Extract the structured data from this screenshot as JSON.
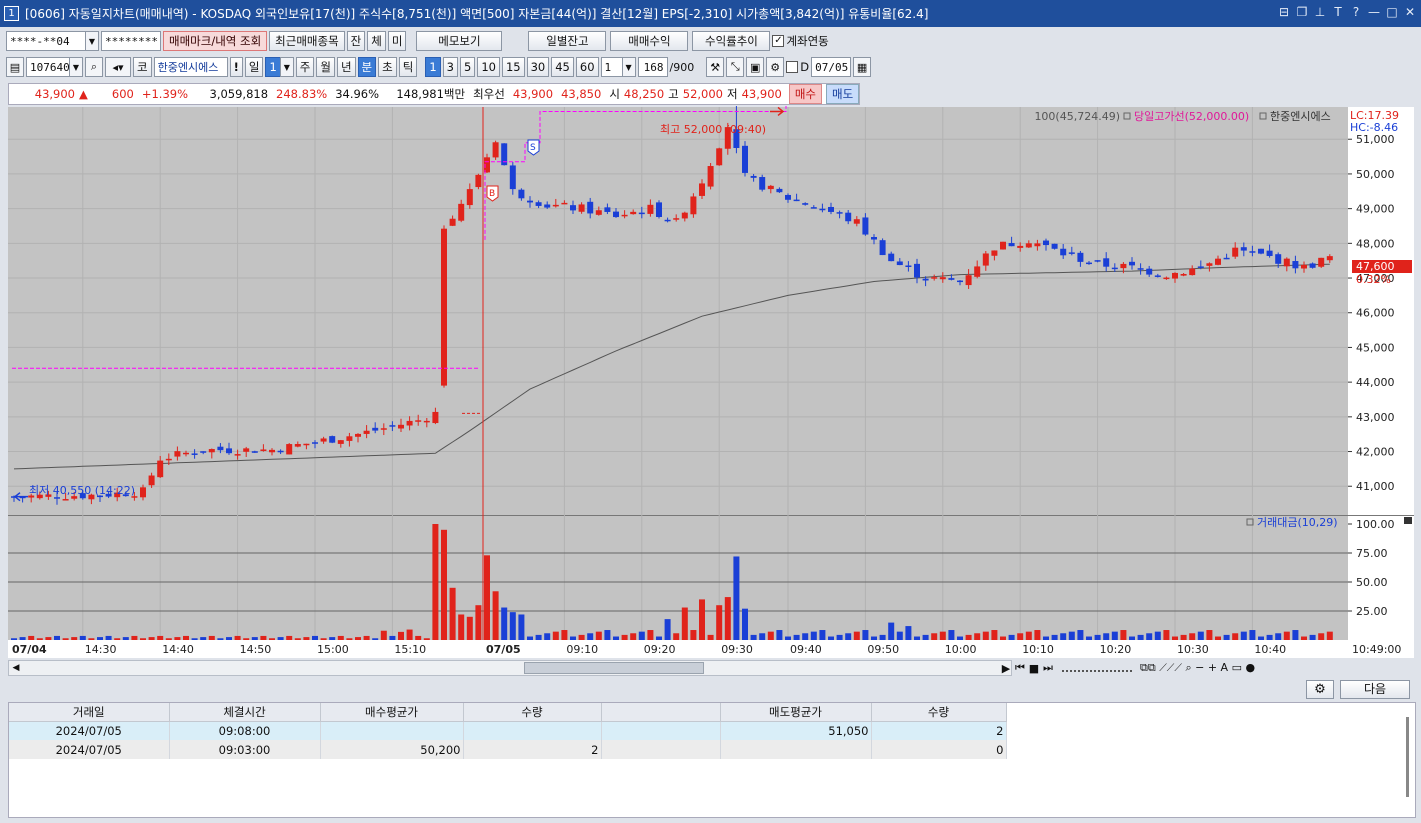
{
  "window": {
    "number": "1",
    "title": "[0606] 자동일지차트(매매내역) - KOSDAQ 외국인보유[17(천)] 주식수[8,751(천)] 액면[500] 자본금[44(억)] 결산[12월] EPS[-2,310] 시가총액[3,842(억)] 유통비율[62.4]"
  },
  "toolbar1": {
    "account": "****-**04",
    "password": "********",
    "btn_mark": "매매마크/내역 조회",
    "btn_recent": "최근매매종목",
    "btn_jan": "잔",
    "btn_che": "체",
    "btn_mi": "미",
    "btn_memo": "메모보기",
    "btn_daily": "일별잔고",
    "btn_profit": "매매수익",
    "btn_rate": "수익률추이",
    "link_label": "계좌연동"
  },
  "toolbar2": {
    "code": "107640",
    "market": "코",
    "name": "한중엔시에스",
    "excl": "!",
    "il": "일",
    "il_num": "1",
    "ju": "주",
    "wol": "월",
    "nyeon": "년",
    "bun": "분",
    "cho": "초",
    "tik": "틱",
    "intervals": [
      "1",
      "3",
      "5",
      "10",
      "15",
      "30",
      "45",
      "60"
    ],
    "mult": "1",
    "count": "168",
    "total": "/900",
    "d_label": "D",
    "date": "07/05"
  },
  "quote": {
    "price": "43,900",
    "arrow": "▲",
    "change": "600",
    "pct": "+1.39%",
    "volume": "3,059,818",
    "vol_ratio": "248.83%",
    "turnover": "34.96%",
    "amount": "148,981백만",
    "best_label": "최우선",
    "best_ask": "43,900",
    "best_bid": "43,850",
    "open_label": "시",
    "open": "48,250",
    "high_label": "고",
    "high": "52,000",
    "low_label": "저",
    "low": "43,900",
    "buy": "매수",
    "sell": "매도"
  },
  "colors": {
    "up": "#e0231b",
    "down": "#1a3fd6",
    "plot_bg": "#c3c3c3",
    "ma": "#555555",
    "highline": "#ff00ff"
  },
  "chart_data": {
    "type": "candlestick",
    "price_ticks": [
      "51,000",
      "50,000",
      "49,000",
      "48,000",
      "47,000",
      "46,000",
      "45,000",
      "44,000",
      "43,000",
      "42,000",
      "41,000"
    ],
    "lc_label": "LC:17.39",
    "hc_label": "HC:-8.46",
    "legend_ma": "100(45,724.49)",
    "legend_high": "당일고가선(52,000.00)",
    "legend_name": "한중엔시에스",
    "current_price": "47,600",
    "current_pct": "0.32%",
    "high_annotation": "최고 52,000 (09:40)",
    "low_annotation": "최저 40,550 (14:22)",
    "buy_marker": "B",
    "sell_marker": "S",
    "volume_title": "거래대금(10,29)",
    "volume_ticks": [
      "100.00",
      "75.00",
      "50.00",
      "25.00"
    ],
    "time_labels": [
      "07/04",
      "14:30",
      "14:40",
      "14:50",
      "15:00",
      "15:10",
      "07/05",
      "09:10",
      "09:20",
      "09:30",
      "09:40",
      "09:50",
      "10:00",
      "10:10",
      "10:20",
      "10:30",
      "10:40",
      "10:49:00"
    ],
    "prev_close_line": 44400,
    "day_high": 52000,
    "day_low": 40550,
    "ylim": [
      40200,
      51900
    ],
    "anchors": [
      [
        0,
        40700
      ],
      [
        10,
        40750
      ],
      [
        15,
        40850
      ],
      [
        17,
        41800
      ],
      [
        22,
        42050
      ],
      [
        30,
        42050
      ],
      [
        40,
        42500
      ],
      [
        47,
        42900
      ],
      [
        49,
        43100
      ],
      [
        50,
        48500
      ],
      [
        53,
        49500
      ],
      [
        56,
        51000
      ],
      [
        58,
        49500
      ],
      [
        62,
        49100
      ],
      [
        66,
        49000
      ],
      [
        70,
        48800
      ],
      [
        74,
        49000
      ],
      [
        77,
        48600
      ],
      [
        80,
        49800
      ],
      [
        83,
        51400
      ],
      [
        85,
        49900
      ],
      [
        90,
        49300
      ],
      [
        94,
        49000
      ],
      [
        98,
        48600
      ],
      [
        102,
        47500
      ],
      [
        106,
        47000
      ],
      [
        110,
        46900
      ],
      [
        114,
        47900
      ],
      [
        118,
        48100
      ],
      [
        122,
        47700
      ],
      [
        126,
        47400
      ],
      [
        130,
        47300
      ],
      [
        134,
        47100
      ],
      [
        138,
        47300
      ],
      [
        142,
        47800
      ],
      [
        146,
        47600
      ],
      [
        150,
        47300
      ],
      [
        153,
        47600
      ]
    ],
    "ma_anchors": [
      [
        0,
        41500
      ],
      [
        49,
        41950
      ],
      [
        53,
        42600
      ],
      [
        60,
        43800
      ],
      [
        70,
        44900
      ],
      [
        80,
        45900
      ],
      [
        90,
        46500
      ],
      [
        100,
        46900
      ],
      [
        110,
        47100
      ],
      [
        120,
        47150
      ],
      [
        130,
        47200
      ],
      [
        140,
        47300
      ],
      [
        153,
        47400
      ]
    ],
    "volume_spikes": [
      [
        49,
        100
      ],
      [
        50,
        95
      ],
      [
        51,
        45
      ],
      [
        52,
        22
      ],
      [
        53,
        20
      ],
      [
        54,
        30
      ],
      [
        55,
        73
      ],
      [
        56,
        42
      ],
      [
        57,
        28
      ],
      [
        58,
        24
      ],
      [
        59,
        22
      ],
      [
        82,
        30
      ],
      [
        83,
        37
      ],
      [
        84,
        72
      ],
      [
        85,
        27
      ],
      [
        76,
        18
      ],
      [
        78,
        28
      ],
      [
        80,
        35
      ],
      [
        102,
        15
      ],
      [
        104,
        12
      ],
      [
        43,
        8
      ],
      [
        45,
        7
      ],
      [
        46,
        9
      ]
    ]
  },
  "scrollbar": {
    "ctrl_icons": [
      "▶",
      "⏮",
      "■",
      "⏭"
    ]
  },
  "bottom": {
    "next_label": "다음",
    "headers": [
      "거래일",
      "체결시간",
      "매수평균가",
      "수량",
      "",
      "매도평균가",
      "수량"
    ],
    "rows": [
      [
        "2024/07/05",
        "09:08:00",
        "",
        "",
        "",
        "51,050",
        "2"
      ],
      [
        "2024/07/05",
        "09:03:00",
        "50,200",
        "2",
        "",
        "",
        "0"
      ]
    ]
  }
}
